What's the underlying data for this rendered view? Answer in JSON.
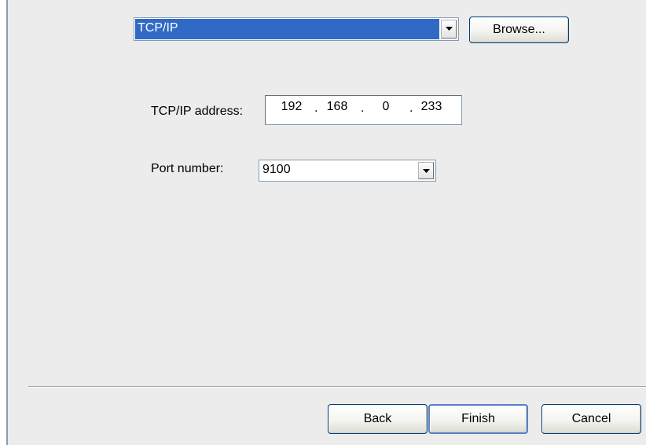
{
  "connection_type": {
    "selected": "TCP/IP"
  },
  "browse_button": {
    "label": "Browse..."
  },
  "tcpip": {
    "label": "TCP/IP address:",
    "octets": [
      "192",
      "168",
      "0",
      "233"
    ]
  },
  "port": {
    "label": "Port number:",
    "value": "9100"
  },
  "footer": {
    "back_label": "Back",
    "finish_label": "Finish",
    "cancel_label": "Cancel"
  },
  "icons": {
    "dropdown": "chevron-down-icon"
  }
}
